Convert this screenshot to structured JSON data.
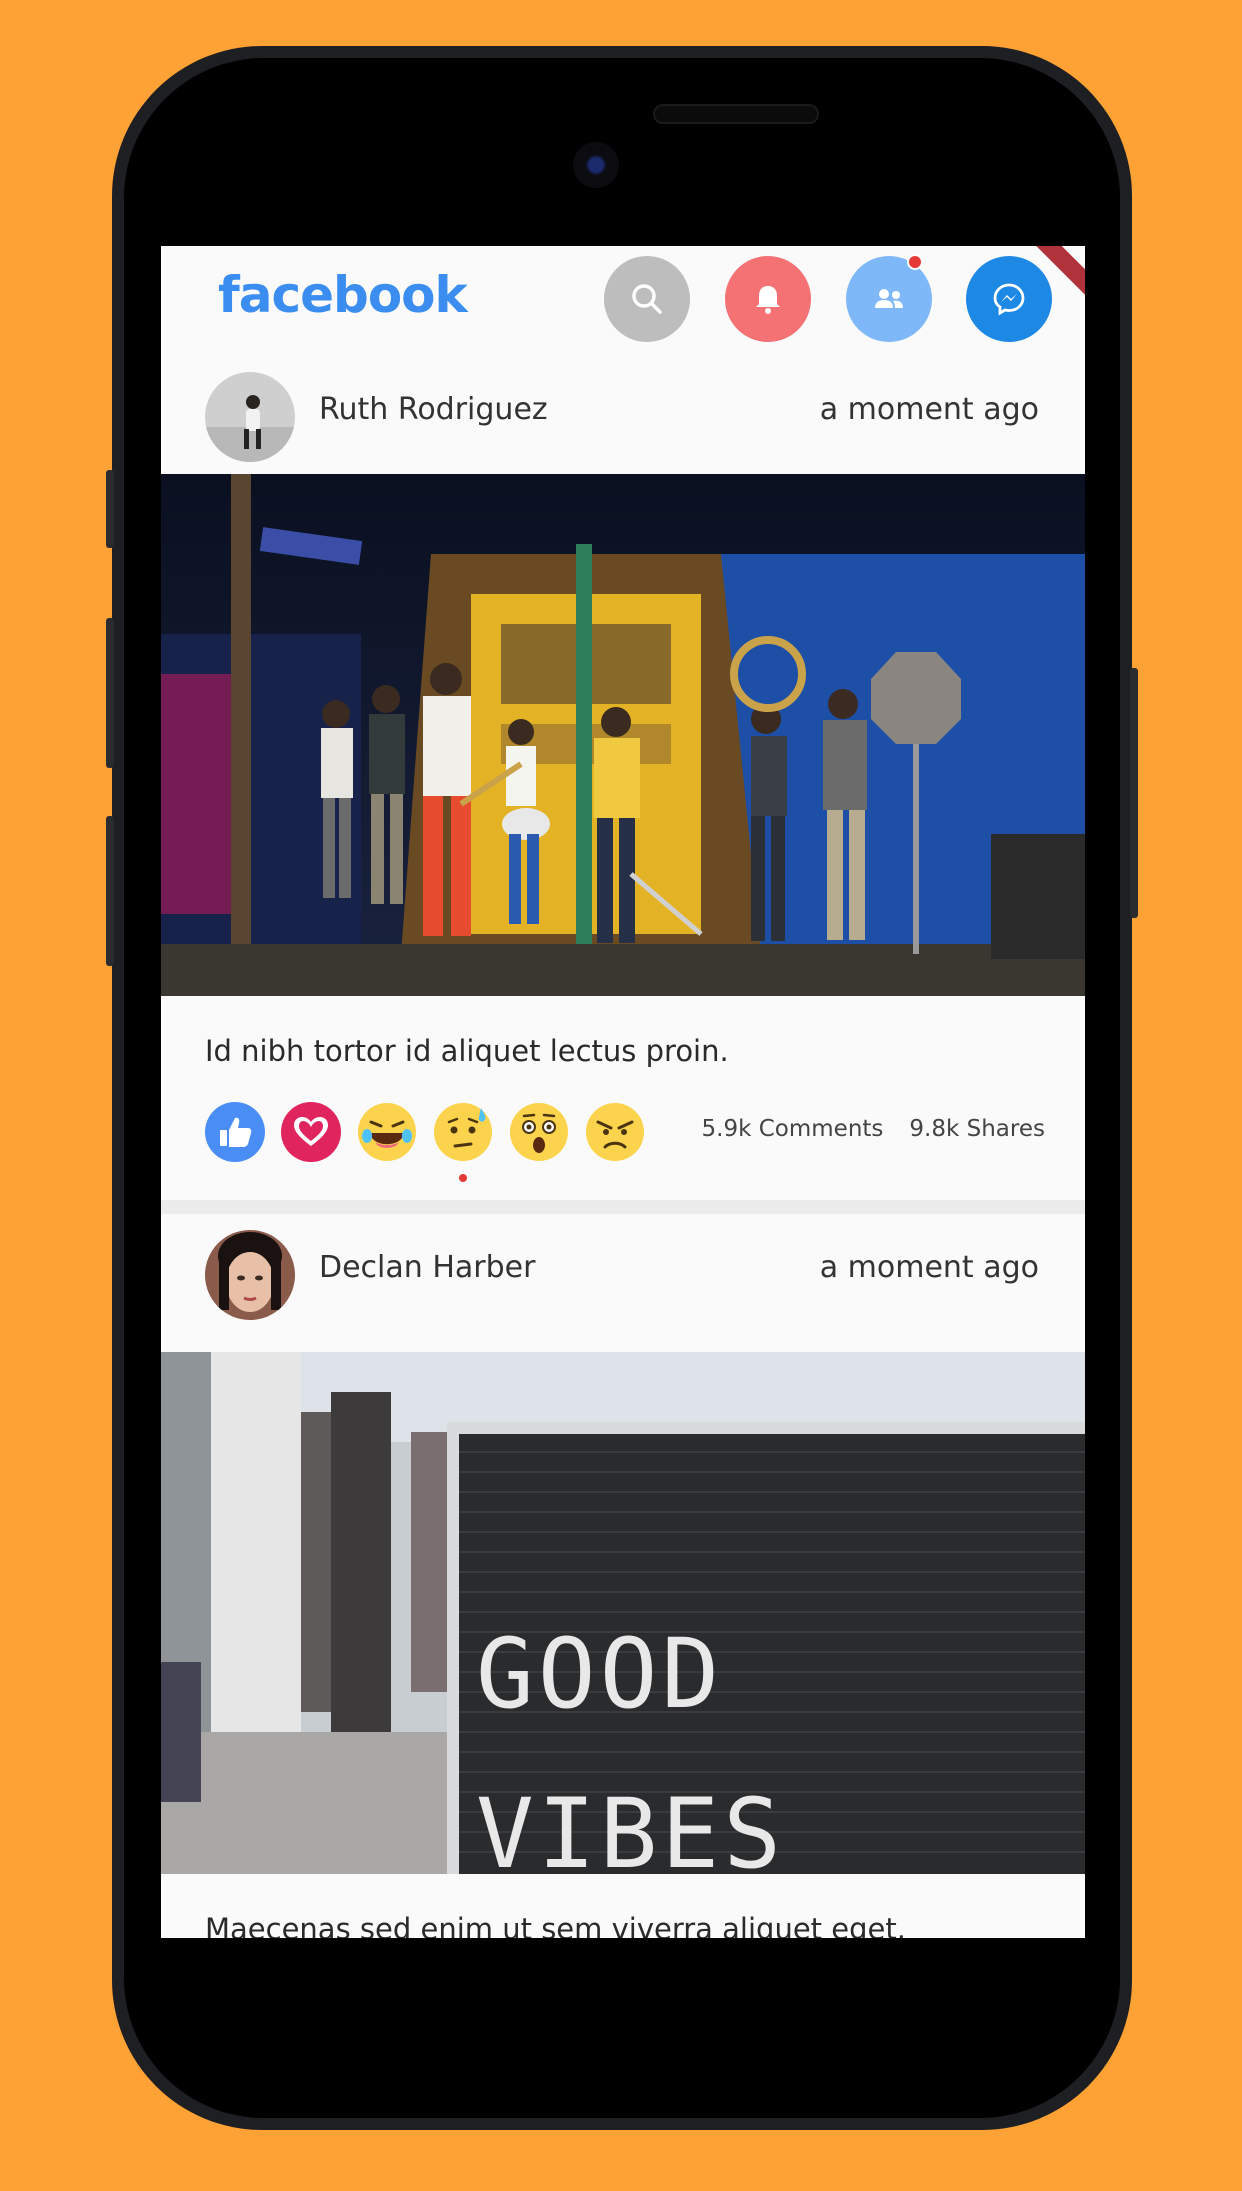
{
  "app": {
    "logo_text": "facebook",
    "brand_color": "#3b8df0",
    "actions": [
      {
        "name": "search-icon",
        "color": "#bdbdbd"
      },
      {
        "name": "bell-icon",
        "color": "#f47174"
      },
      {
        "name": "people-icon",
        "color": "#7fb8f8",
        "has_notification": true
      },
      {
        "name": "messenger-icon",
        "color": "#1e88e5"
      }
    ]
  },
  "posts": [
    {
      "author": "Ruth Rodriguez",
      "time": "a moment ago",
      "caption": "Id nibh tortor id aliquet lectus proin.",
      "comments": "5.9k Comments",
      "shares": "9.8k Shares",
      "reactions": [
        "like-icon",
        "love-icon",
        "laugh-icon",
        "sad-sweat-icon",
        "wow-icon",
        "angry-icon"
      ],
      "selected_reaction": "sad-sweat-icon"
    },
    {
      "author": "Declan Harber",
      "time": "a moment ago",
      "caption": "Maecenas sed enim ut sem viverra aliquet eget.",
      "image_text_line1": "GOOD",
      "image_text_line2": "VIBES"
    }
  ]
}
